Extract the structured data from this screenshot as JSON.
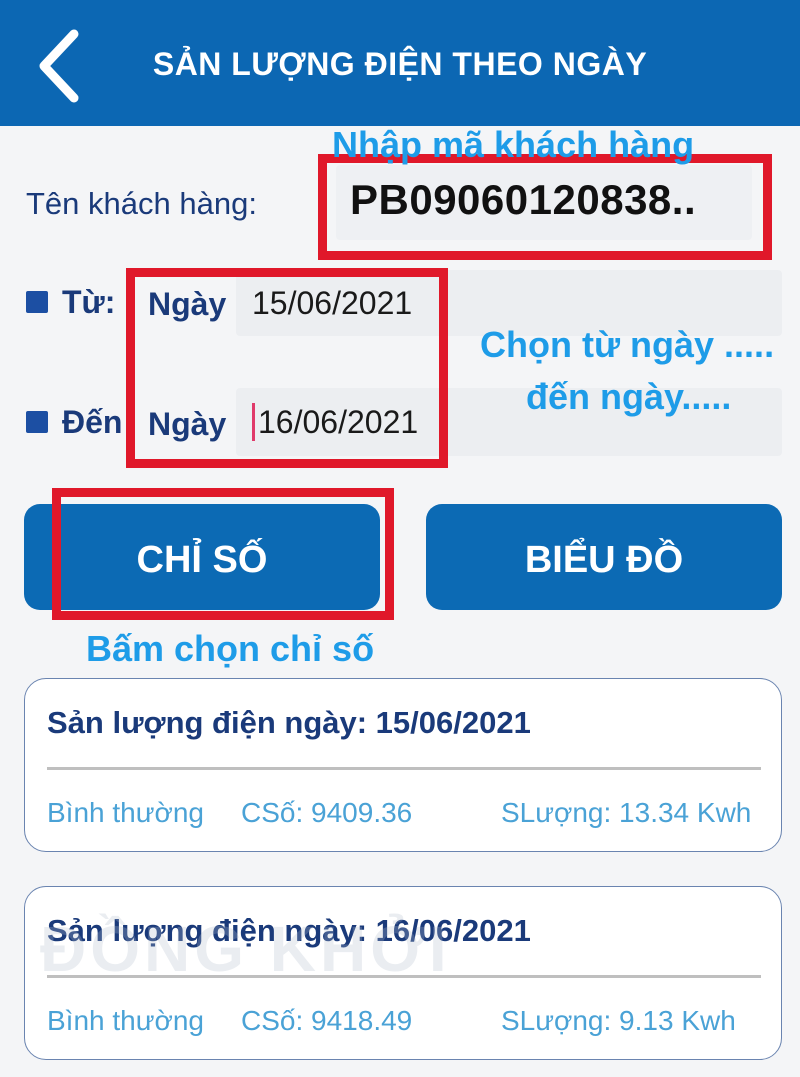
{
  "header": {
    "title": "SẢN LƯỢNG ĐIỆN THEO NGÀY",
    "back_icon": "chevron-left-icon"
  },
  "form": {
    "customer_label": "Tên khách hàng:",
    "customer_value": "PB09060120838..",
    "from_label": "Từ:",
    "to_label": "Đến",
    "day_label": "Ngày",
    "from_date": "15/06/2021",
    "to_date": "16/06/2021"
  },
  "buttons": {
    "chi_so": "CHỈ SỐ",
    "bieu_do": "BIỂU ĐỒ"
  },
  "records": [
    {
      "title": "Sản lượng điện ngày: 15/06/2021",
      "type": "Bình thường",
      "chiso": "CSố: 9409.36",
      "sanluong": "SLượng: 13.34 Kwh"
    },
    {
      "title": "Sản lượng điện ngày: 16/06/2021",
      "type": "Bình thường",
      "chiso": "CSố: 9418.49",
      "sanluong": "SLượng: 9.13 Kwh"
    }
  ],
  "annotations": {
    "enter_code": "Nhập mã khách hàng",
    "choose_dates_line1": "Chọn từ ngày .....",
    "choose_dates_line2": "đến ngày.....",
    "press_chiso": "Bấm chọn chỉ số"
  },
  "watermark": "ĐỒNG KHỞI",
  "colors": {
    "header": "#0c67b3",
    "button": "#0c6ab4",
    "annotation_box": "#e0182a",
    "annotation_text": "#1e9ce8"
  }
}
